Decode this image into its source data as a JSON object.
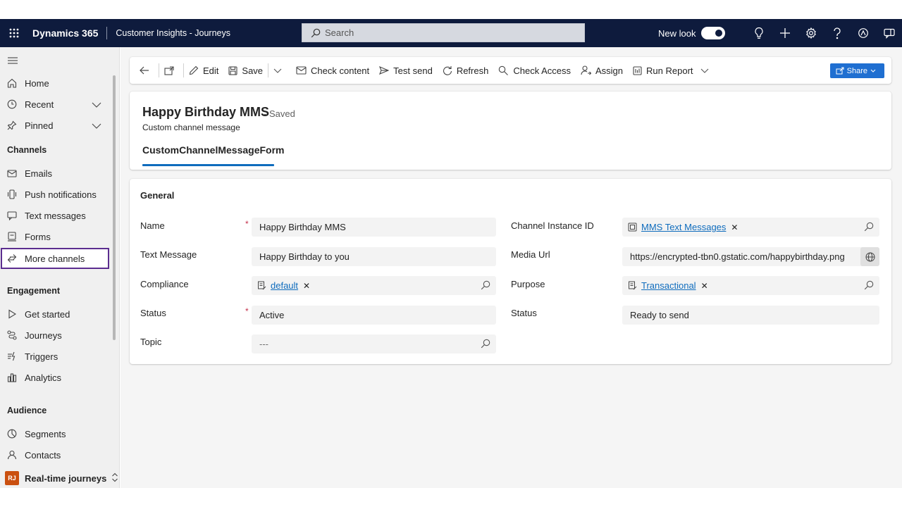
{
  "topbar": {
    "brand": "Dynamics 365",
    "app_name": "Customer Insights - Journeys",
    "search_placeholder": "Search",
    "new_look_label": "New look"
  },
  "sidebar": {
    "recent": "Recent",
    "pinned": "Pinned",
    "home": "Home",
    "sections": {
      "channels": "Channels",
      "engagement": "Engagement",
      "audience": "Audience"
    },
    "channels": [
      "Emails",
      "Push notifications",
      "Text messages",
      "Forms",
      "More channels"
    ],
    "engagement": [
      "Get started",
      "Journeys",
      "Triggers",
      "Analytics"
    ],
    "audience": [
      "Segments",
      "Contacts"
    ],
    "area_badge": "RJ",
    "area_name": "Real-time journeys"
  },
  "toolbar": {
    "edit": "Edit",
    "save": "Save",
    "check_content": "Check content",
    "test_send": "Test send",
    "refresh": "Refresh",
    "check_access": "Check Access",
    "assign": "Assign",
    "run_report": "Run Report",
    "share": "Share"
  },
  "record": {
    "title": "Happy Birthday MMS",
    "status": "- Saved",
    "entity": "Custom channel message",
    "form_tab": "CustomChannelMessageForm"
  },
  "general": {
    "section_title": "General",
    "name_label": "Name",
    "name_value": "Happy Birthday MMS",
    "text_message_label": "Text Message",
    "text_message_value": "Happy Birthday to you",
    "compliance_label": "Compliance",
    "compliance_value": "default",
    "status_label": "Status",
    "status_value": "Active",
    "topic_label": "Topic",
    "topic_value": "---",
    "channel_instance_label": "Channel Instance ID",
    "channel_instance_value": "MMS Text Messages",
    "media_url_label": "Media Url",
    "media_url_value": "https://encrypted-tbn0.gstatic.com/happybirthday.png",
    "purpose_label": "Purpose",
    "purpose_value": "Transactional",
    "status2_label": "Status",
    "status2_value": "Ready to send"
  },
  "colors": {
    "topbar": "#0e1b3d",
    "accent": "#0f6cbd",
    "selected_outline": "#5b2d8f",
    "badge": "#ca5010"
  }
}
